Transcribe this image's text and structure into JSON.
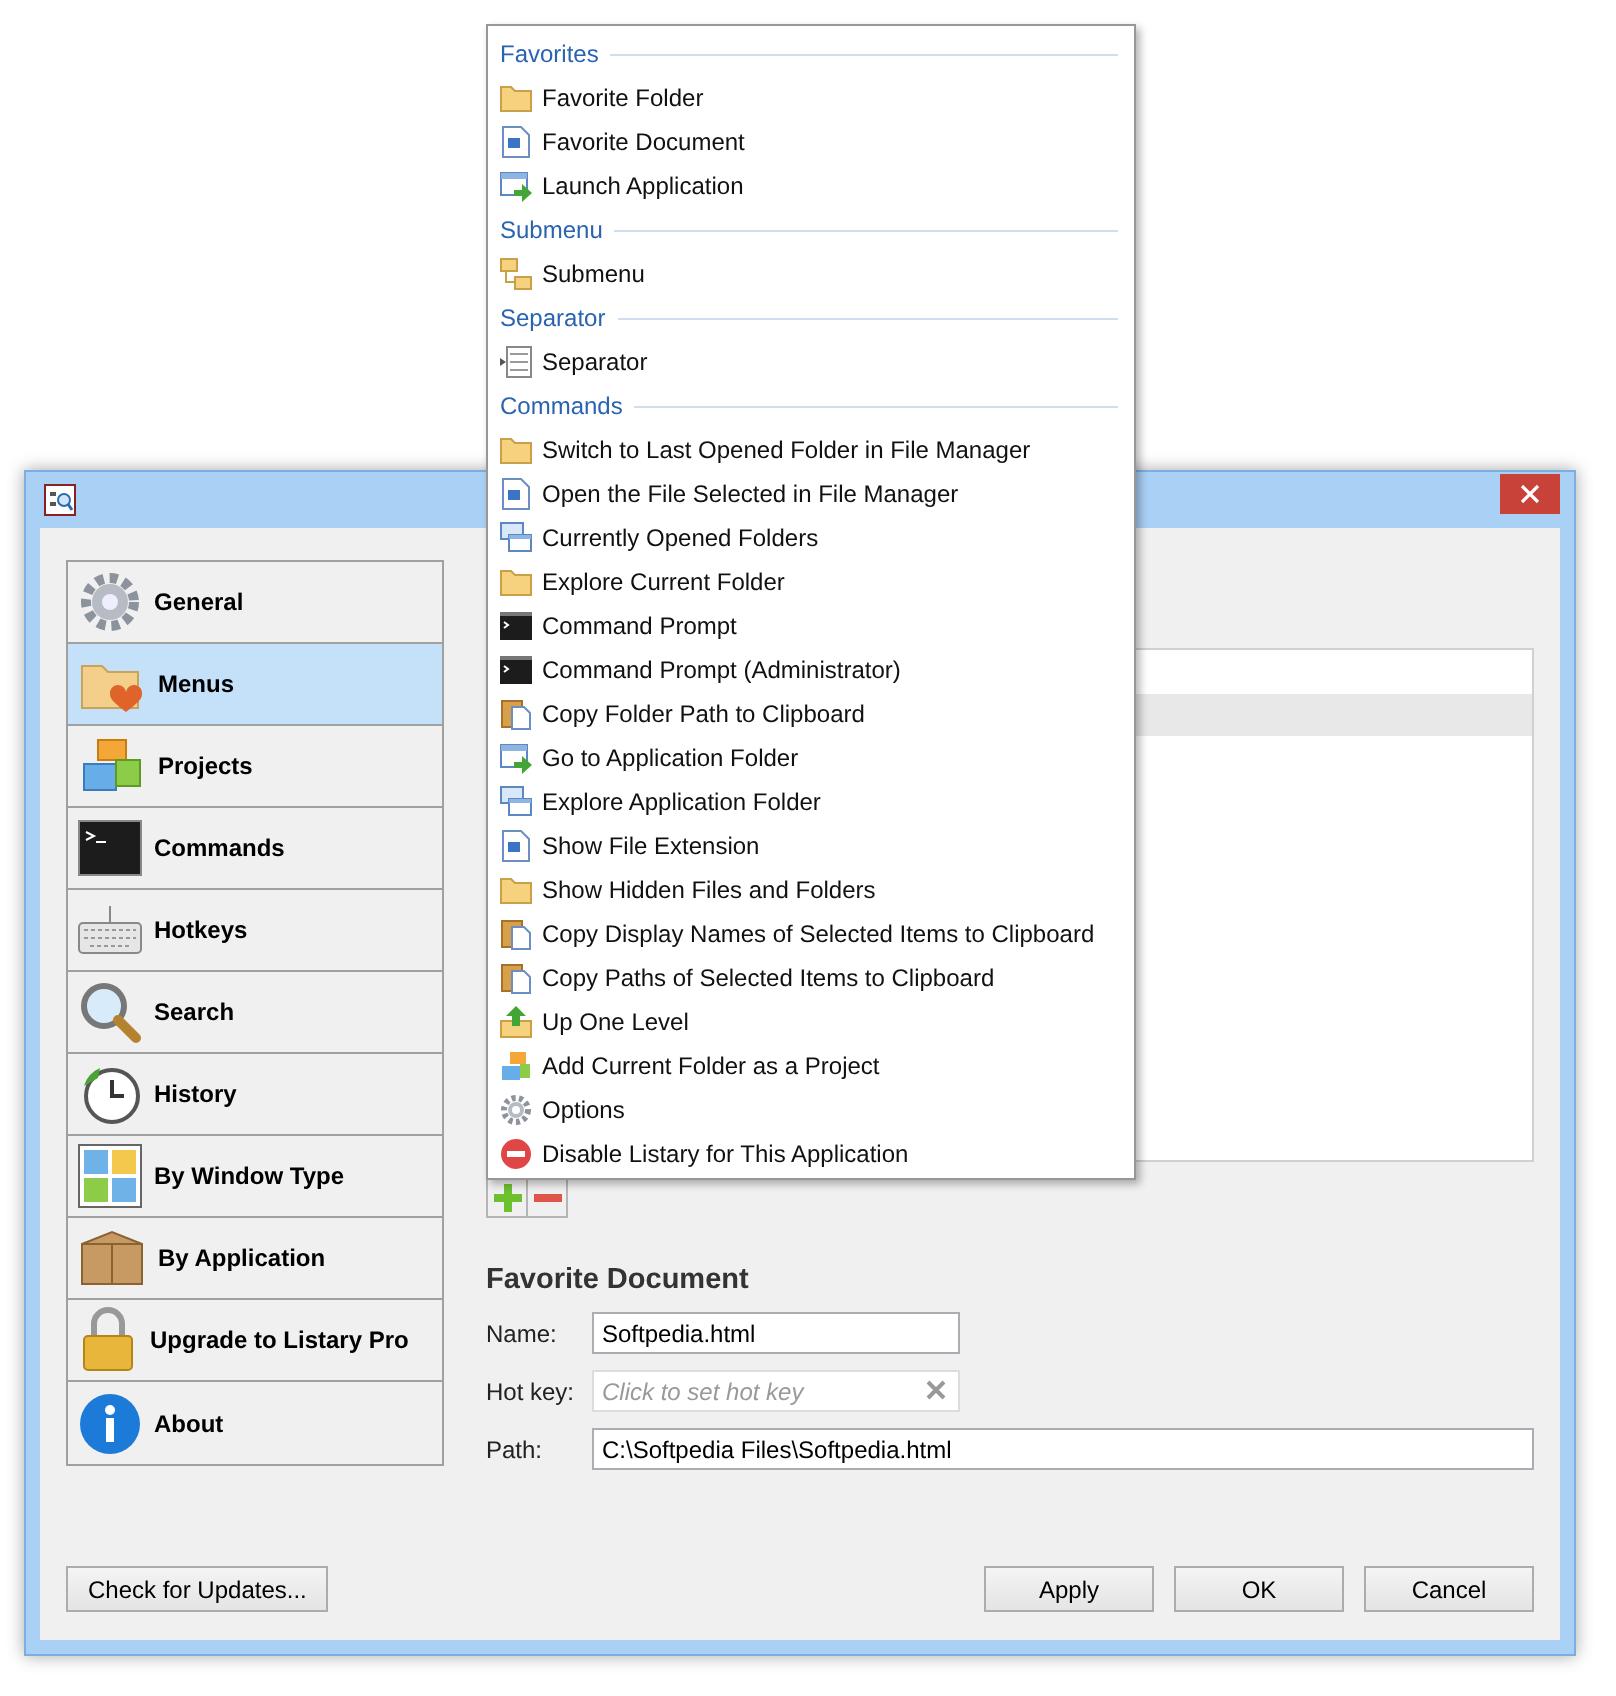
{
  "sidebar": {
    "items": [
      {
        "label": "General",
        "selected": false
      },
      {
        "label": "Menus",
        "selected": true
      },
      {
        "label": "Projects",
        "selected": false
      },
      {
        "label": "Commands",
        "selected": false
      },
      {
        "label": "Hotkeys",
        "selected": false
      },
      {
        "label": "Search",
        "selected": false
      },
      {
        "label": "History",
        "selected": false
      },
      {
        "label": "By Window Type",
        "selected": false
      },
      {
        "label": "By Application",
        "selected": false
      },
      {
        "label": "Upgrade to Listary Pro",
        "selected": false
      },
      {
        "label": "About",
        "selected": false
      }
    ]
  },
  "check_updates_button": "Check for Updates...",
  "editor": {
    "heading": "Favorite Document",
    "fields": [
      {
        "kind": "text",
        "label": "Name:",
        "value": "Softpedia.html"
      },
      {
        "kind": "hotkey",
        "label": "Hot key:",
        "placeholder": "Click to set hot key"
      },
      {
        "kind": "wide",
        "label": "Path:",
        "value": "C:\\Softpedia Files\\Softpedia.html"
      }
    ]
  },
  "buttons": [
    "Apply",
    "OK",
    "Cancel"
  ],
  "popup_menu": {
    "sections": [
      {
        "header": "Favorites",
        "items": [
          {
            "label": "Favorite Folder"
          },
          {
            "label": "Favorite Document"
          },
          {
            "label": "Launch Application"
          }
        ]
      },
      {
        "header": "Submenu",
        "items": [
          {
            "label": "Submenu"
          }
        ]
      },
      {
        "header": "Separator",
        "items": [
          {
            "label": "Separator"
          }
        ]
      },
      {
        "header": "Commands",
        "items": [
          {
            "label": "Switch to Last Opened Folder in File Manager"
          },
          {
            "label": "Open the File Selected in File Manager"
          },
          {
            "label": "Currently Opened Folders"
          },
          {
            "label": "Explore Current Folder"
          },
          {
            "label": "Command Prompt"
          },
          {
            "label": "Command Prompt (Administrator)"
          },
          {
            "label": "Copy Folder Path to Clipboard"
          },
          {
            "label": "Go to Application Folder"
          },
          {
            "label": "Explore Application Folder"
          },
          {
            "label": "Show File Extension"
          },
          {
            "label": "Show Hidden Files and Folders"
          },
          {
            "label": "Copy Display Names of Selected Items to Clipboard"
          },
          {
            "label": "Copy Paths of Selected Items to Clipboard"
          },
          {
            "label": "Up One Level"
          },
          {
            "label": "Add Current Folder as a Project"
          },
          {
            "label": "Options"
          },
          {
            "label": "Disable Listary for This Application"
          }
        ]
      }
    ]
  }
}
